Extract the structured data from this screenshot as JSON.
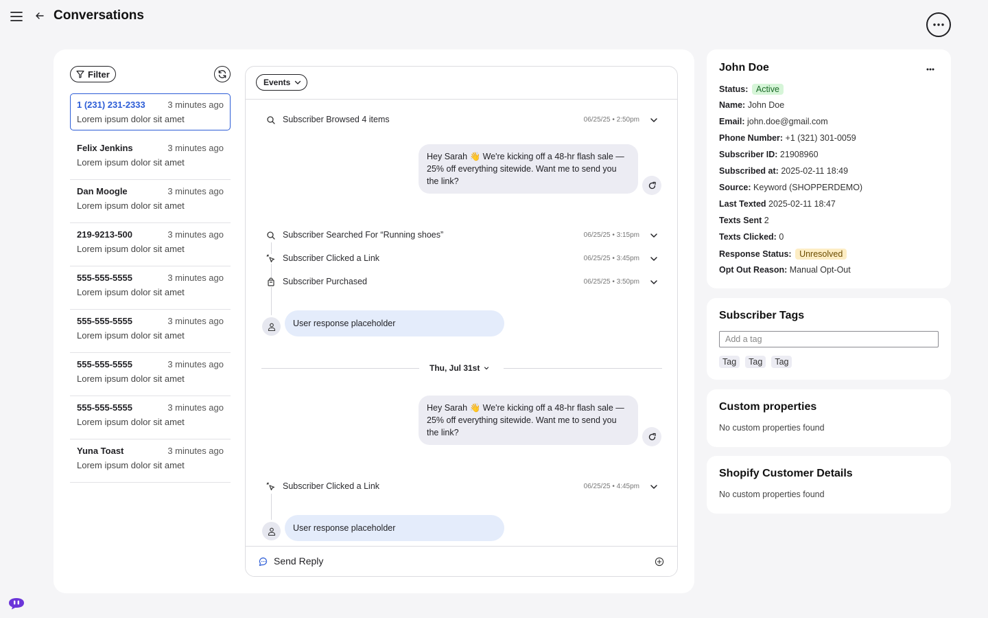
{
  "header": {
    "title": "Conversations"
  },
  "filter": {
    "label": "Filter"
  },
  "conversations": [
    {
      "name": "1 (231) 231-2333",
      "time": "3 minutes ago",
      "preview": "Lorem ipsum dolor sit amet",
      "selected": true
    },
    {
      "name": "Felix Jenkins",
      "time": "3 minutes ago",
      "preview": "Lorem ipsum dolor sit amet"
    },
    {
      "name": "Dan Moogle",
      "time": "3 minutes ago",
      "preview": "Lorem ipsum dolor sit amet"
    },
    {
      "name": "219-9213-500",
      "time": "3 minutes ago",
      "preview": "Lorem ipsum dolor sit amet"
    },
    {
      "name": "555-555-5555",
      "time": "3 minutes ago",
      "preview": "Lorem ipsum dolor sit amet"
    },
    {
      "name": "555-555-5555",
      "time": "3 minutes ago",
      "preview": "Lorem ipsum dolor sit amet"
    },
    {
      "name": "555-555-5555",
      "time": "3 minutes ago",
      "preview": "Lorem ipsum dolor sit amet"
    },
    {
      "name": "555-555-5555",
      "time": "3 minutes ago",
      "preview": "Lorem ipsum dolor sit amet"
    },
    {
      "name": "Yuna Toast",
      "time": "3 minutes ago",
      "preview": "Lorem ipsum dolor sit amet"
    }
  ],
  "timeline": {
    "events_label": "Events",
    "events": [
      {
        "icon": "search-icon",
        "text": "Subscriber Browsed 4 items",
        "time": "06/25/25 • 2:50pm"
      },
      {
        "icon": "search-icon",
        "text": "Subscriber Searched For “Running shoes”",
        "time": "06/25/25 • 3:15pm"
      },
      {
        "icon": "cursor-click-icon",
        "text": "Subscriber Clicked a Link",
        "time": "06/25/25 • 3:45pm"
      },
      {
        "icon": "shopping-bag-icon",
        "text": "Subscriber Purchased",
        "time": "06/25/25 • 3:50pm"
      },
      {
        "icon": "cursor-click-icon",
        "text": "Subscriber Clicked a Link",
        "time": "06/25/25 • 4:45pm"
      }
    ],
    "messages": [
      {
        "text": "Hey Sarah 👋 We're kicking off a 48-hr flash sale — 25% off everything sitewide. Want me to send you the link?"
      },
      {
        "text": "Hey Sarah 👋 We're kicking off a 48-hr flash sale — 25% off everything sitewide. Want me to send you the link?"
      }
    ],
    "user_responses": [
      {
        "text": "User response placeholder"
      },
      {
        "text": "User response placeholder"
      }
    ],
    "date_separator": "Thu, Jul 31st",
    "reply_label": "Send Reply"
  },
  "subscriber": {
    "name": "John Doe",
    "fields": [
      {
        "label": "Status:",
        "value": "Active",
        "badge": "active"
      },
      {
        "label": "Name:",
        "value": "John Doe"
      },
      {
        "label": "Email:",
        "value": "john.doe@gmail.com"
      },
      {
        "label": "Phone Number:",
        "value": "+1 (321) 301-0059"
      },
      {
        "label": "Subscriber ID:",
        "value": "21908960"
      },
      {
        "label": "Subscribed at:",
        "value": "2025-02-11 18:49"
      },
      {
        "label": "Source:",
        "value": "Keyword (SHOPPERDEMO)"
      },
      {
        "label": "Last Texted",
        "value": "2025-02-11 18:47"
      },
      {
        "label": "Texts Sent",
        "value": "2"
      },
      {
        "label": "Texts Clicked:",
        "value": "0"
      },
      {
        "label": "Response Status:",
        "value": "Unresolved",
        "badge": "unresolved"
      },
      {
        "label": "Opt Out Reason:",
        "value": "Manual Opt-Out"
      }
    ]
  },
  "tags": {
    "title": "Subscriber Tags",
    "placeholder": "Add a tag",
    "items": [
      "Tag",
      "Tag",
      "Tag"
    ]
  },
  "custom_properties": {
    "title": "Custom properties",
    "empty": "No custom properties found"
  },
  "shopify": {
    "title": "Shopify Customer Details",
    "empty": "No custom properties found"
  },
  "colors": {
    "accent": "#2b5cd6",
    "active_badge": "#d6f5d8",
    "unresolved_badge": "#fdedc4",
    "brand": "#6b35d9"
  }
}
